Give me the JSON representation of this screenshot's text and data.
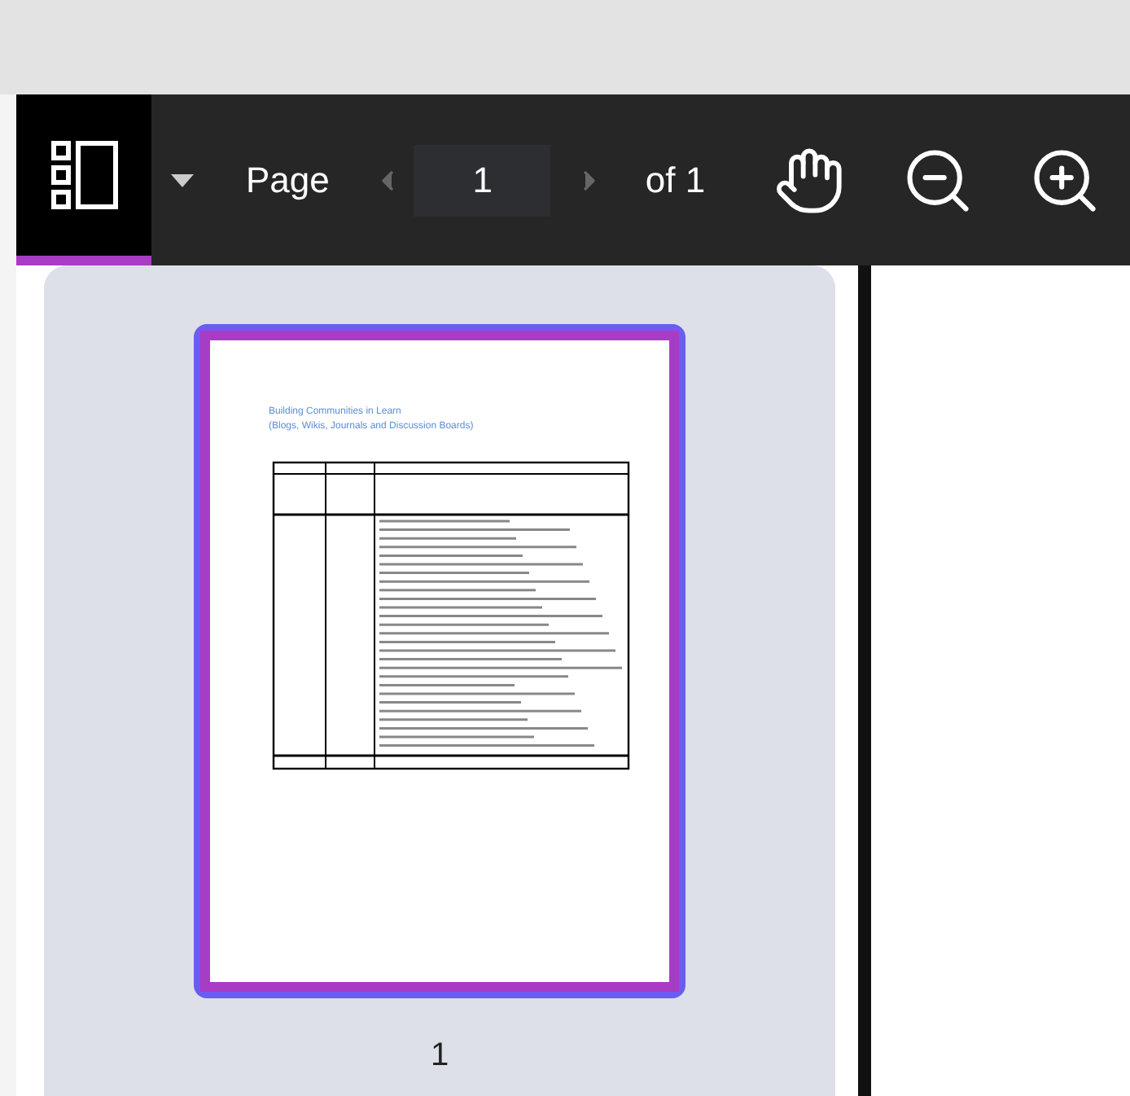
{
  "toolbar": {
    "sidebar_toggle": {
      "selected": true
    },
    "page_label": "Page",
    "page_input": "1",
    "previous_disabled": true,
    "next_disabled": true,
    "page_total": "of 1"
  },
  "thumbnails": [
    {
      "page_number": "1",
      "selected": true,
      "doc_title": [
        "Building Communities in Learn",
        "(Blogs, Wikis, Journals and Discussion Boards)"
      ]
    }
  ]
}
